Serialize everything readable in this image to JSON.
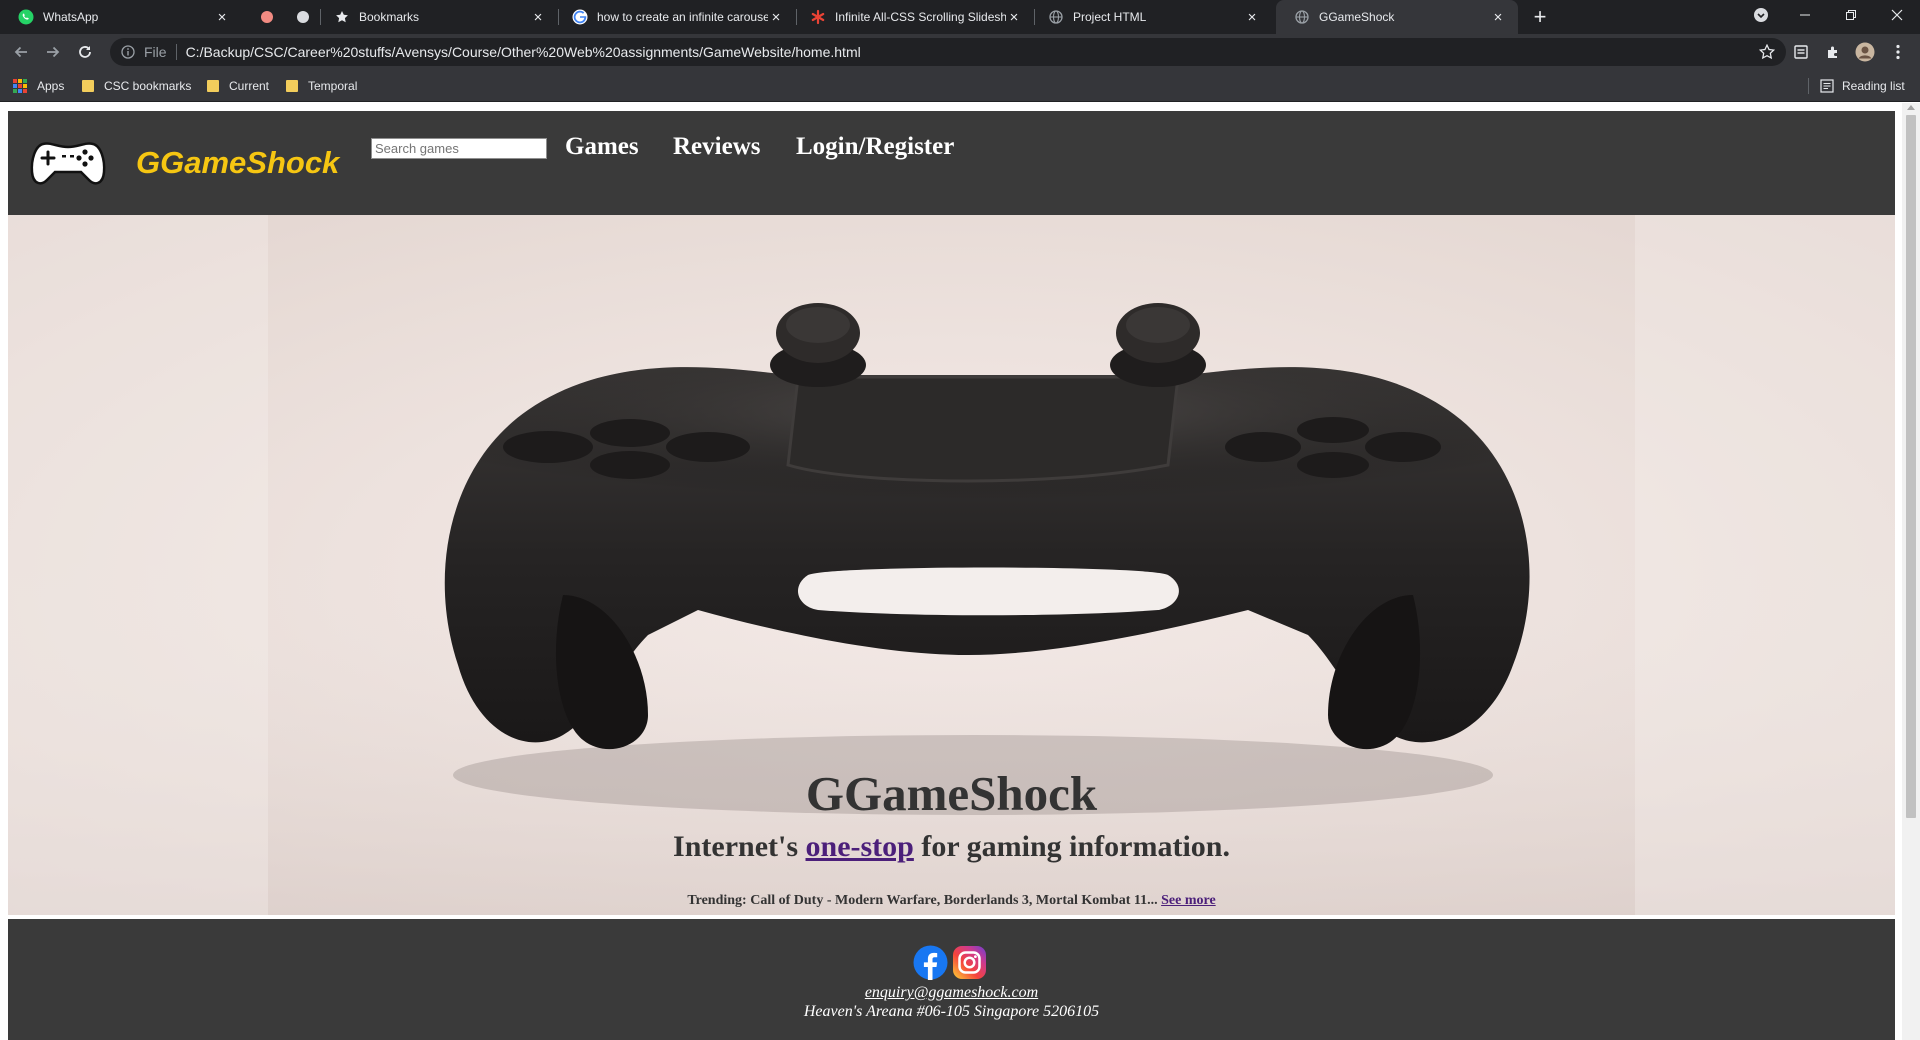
{
  "browser": {
    "tabs": [
      {
        "title": "WhatsApp",
        "icon": "whatsapp-icon"
      },
      {
        "title": "",
        "icon": "red-dot-icon"
      },
      {
        "title": "",
        "icon": "grey-dot-icon"
      },
      {
        "title": "Bookmarks",
        "icon": "star-icon"
      },
      {
        "title": "how to create an infinite carousel",
        "icon": "google-icon"
      },
      {
        "title": "Infinite All-CSS Scrolling Slideshow",
        "icon": "asterisk-icon"
      },
      {
        "title": "Project HTML",
        "icon": "globe-icon"
      },
      {
        "title": "GGameShock",
        "icon": "globe-icon"
      }
    ],
    "active_tab_index": 7,
    "address": {
      "scheme_label": "File",
      "url": "C:/Backup/CSC/Career%20stuffs/Avensys/Course/Other%20Web%20assignments/GameWebsite/home.html"
    },
    "bookmarks_bar": {
      "apps_label": "Apps",
      "items": [
        {
          "label": "CSC bookmarks"
        },
        {
          "label": "Current"
        },
        {
          "label": "Temporal"
        }
      ],
      "reading_list_label": "Reading list"
    }
  },
  "site": {
    "brand": "GGameShock",
    "search": {
      "placeholder": "Search games",
      "value": ""
    },
    "nav": [
      {
        "label": "Games"
      },
      {
        "label": "Reviews"
      },
      {
        "label": "Login/Register"
      }
    ],
    "hero": {
      "title": "GGameShock",
      "tagline_before": "Internet's ",
      "tagline_link": "one-stop",
      "tagline_after": " for gaming information.",
      "trending_text": "Trending: Call of Duty - Modern Warfare, Borderlands 3, Mortal Kombat 11...",
      "trending_link": "See more"
    },
    "footer": {
      "social": [
        "facebook-icon",
        "instagram-icon"
      ],
      "email": "enquiry@ggameshock.com",
      "address": "Heaven's Areana #06-105 Singapore 5206105"
    }
  },
  "colors": {
    "header_bg": "#3a3a3a",
    "brand_yellow": "#f6c612",
    "link_purple": "#4b1f7a",
    "chrome_dark": "#202124",
    "chrome_toolbar": "#35363a"
  }
}
